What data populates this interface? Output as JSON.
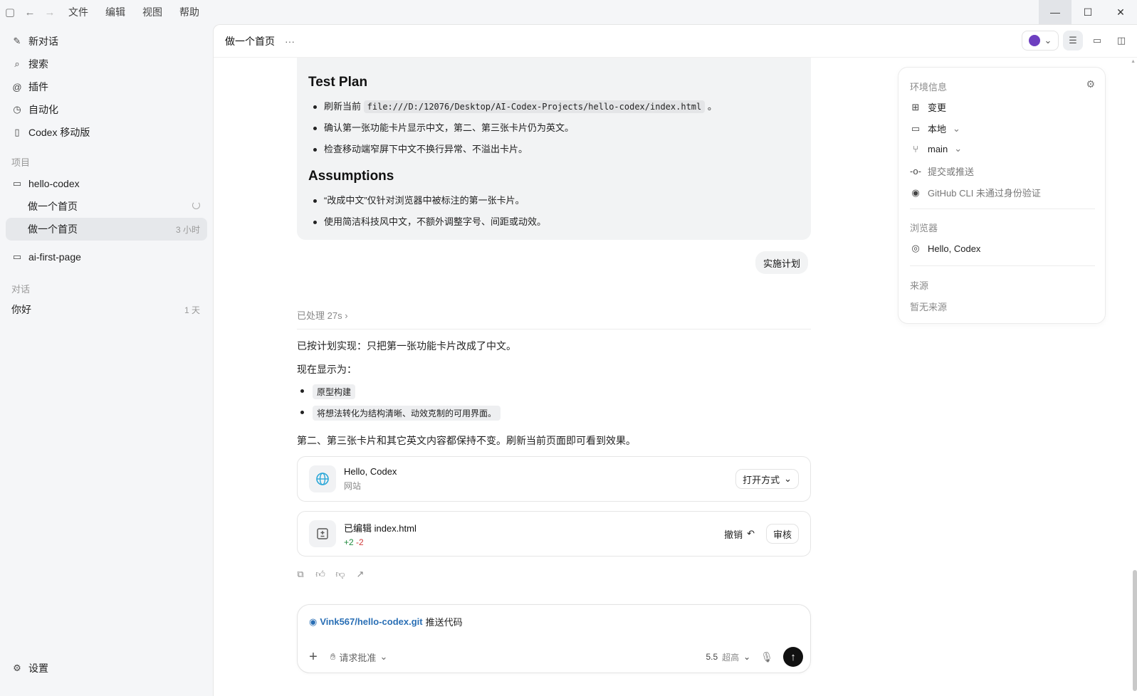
{
  "titlebar": {
    "menu": [
      "文件",
      "编辑",
      "视图",
      "帮助"
    ]
  },
  "sidebar": {
    "nav": {
      "new_chat": "新对话",
      "search": "搜索",
      "plugins": "插件",
      "automation": "自动化",
      "mobile": "Codex 移动版"
    },
    "projects_label": "项目",
    "projects": [
      {
        "name": "hello-codex",
        "threads": [
          {
            "title": "做一个首页",
            "meta": ""
          },
          {
            "title": "做一个首页",
            "meta": "3 小时"
          }
        ]
      },
      {
        "name": "ai-first-page"
      }
    ],
    "chats_label": "对话",
    "chats": [
      {
        "title": "你好",
        "meta": "1 天"
      }
    ],
    "settings": "设置"
  },
  "header": {
    "title": "做一个首页",
    "more": "···"
  },
  "plan": {
    "test_plan_title": "Test Plan",
    "test_items": [
      {
        "prefix": "刷新当前",
        "code": "file:///D:/12076/Desktop/AI-Codex-Projects/hello-codex/index.html",
        "suffix": "。"
      },
      {
        "text": "确认第一张功能卡片显示中文，第二、第三张卡片仍为英文。"
      },
      {
        "text": "检查移动端窄屏下中文不换行异常、不溢出卡片。"
      }
    ],
    "assumptions_title": "Assumptions",
    "assumptions": [
      "“改成中文”仅针对浏览器中被标注的第一张卡片。",
      "使用简洁科技风中文，不额外调整字号、间距或动效。"
    ]
  },
  "user_bubble": "实施计划",
  "processed": "已处理 27s",
  "response": {
    "line1": "已按计划实现：只把第一张功能卡片改成了中文。",
    "line2": "现在显示为：",
    "chips": [
      "原型构建",
      "将想法转化为结构清晰、动效克制的可用界面。"
    ],
    "line3": "第二、第三张卡片和其它英文内容都保持不变。刷新当前页面即可看到效果。"
  },
  "site_card": {
    "title": "Hello, Codex",
    "subtitle": "网站",
    "open_with": "打开方式"
  },
  "edit_card": {
    "title": "已编辑 index.html",
    "added": "+2",
    "removed": "-2",
    "undo": "撤销",
    "review": "审核"
  },
  "composer": {
    "repo": "Vink567/hello-codex.git",
    "text": "推送代码",
    "approval": "请求批准",
    "model": "5.5",
    "level": "超高"
  },
  "info_panel": {
    "env_label": "环境信息",
    "changes": "变更",
    "local": "本地",
    "branch": "main",
    "commit": "提交或推送",
    "github": "GitHub CLI 未通过身份验证",
    "browser_label": "浏览器",
    "browser_item": "Hello, Codex",
    "source_label": "来源",
    "source_empty": "暂无来源"
  }
}
